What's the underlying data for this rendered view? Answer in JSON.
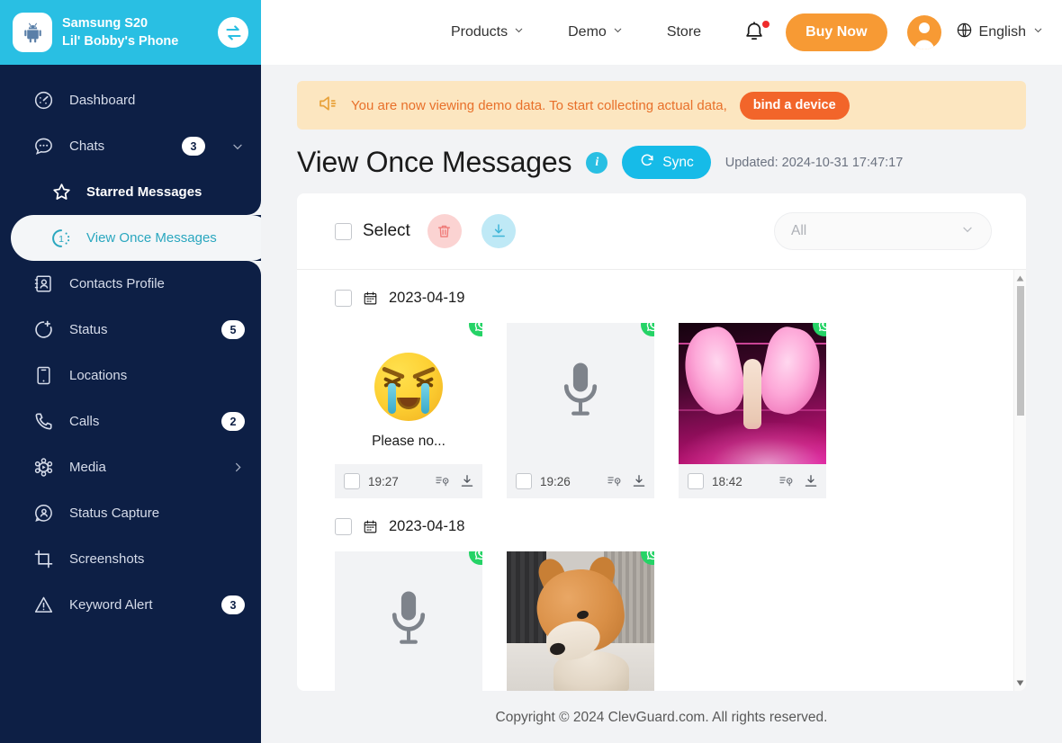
{
  "device": {
    "name": "Samsung S20",
    "sub": "Lil' Bobby's Phone",
    "logo_icon": "android-icon",
    "switch_icon": "switch-device-icon"
  },
  "sidebar": {
    "items": [
      {
        "label": "Dashboard",
        "icon": "dashboard-icon",
        "badge": ""
      },
      {
        "label": "Chats",
        "icon": "chats-icon",
        "badge": "3",
        "chevron": "chevron-down-icon"
      },
      {
        "label": "Contacts Profile",
        "icon": "contacts-profile-icon",
        "badge": ""
      },
      {
        "label": "Status",
        "icon": "status-icon",
        "badge": "5"
      },
      {
        "label": "Locations",
        "icon": "locations-icon",
        "badge": ""
      },
      {
        "label": "Calls",
        "icon": "calls-icon",
        "badge": "2"
      },
      {
        "label": "Media",
        "icon": "media-icon",
        "badge": "",
        "chevron": "chevron-right-icon"
      },
      {
        "label": "Status Capture",
        "icon": "status-capture-icon",
        "badge": ""
      },
      {
        "label": "Screenshots",
        "icon": "screenshots-icon",
        "badge": ""
      },
      {
        "label": "Keyword Alert",
        "icon": "keyword-alert-icon",
        "badge": "3"
      }
    ],
    "sub_items": [
      {
        "label": "Starred Messages",
        "icon": "star-icon",
        "active": false
      },
      {
        "label": "View Once Messages",
        "icon": "view-once-icon",
        "active": true
      }
    ]
  },
  "topnav": {
    "links": [
      {
        "label": "Products",
        "chevron": true
      },
      {
        "label": "Demo",
        "chevron": true
      },
      {
        "label": "Store",
        "chevron": false
      }
    ],
    "bell_icon": "notification-bell-icon",
    "buy_now": "Buy Now",
    "avatar_icon": "user-avatar-icon",
    "language": "English",
    "globe_icon": "globe-icon"
  },
  "banner": {
    "icon": "megaphone-icon",
    "text": "You are now viewing demo data. To start collecting actual data,",
    "button": "bind a device"
  },
  "page": {
    "title": "View Once Messages",
    "info_icon": "info-icon",
    "info_glyph": "i",
    "sync_label": "Sync",
    "sync_icon": "sync-icon",
    "updated": "Updated: 2024-10-31 17:47:17"
  },
  "toolbar": {
    "select_label": "Select",
    "delete_icon": "trash-icon",
    "download_icon": "download-icon",
    "filter_value": "All",
    "filter_chevron": "chevron-down-icon"
  },
  "groups": [
    {
      "date": "2023-04-19",
      "calendar_icon": "calendar-icon",
      "cards": [
        {
          "kind": "text",
          "caption": "Please no...",
          "time": "19:27",
          "app": "whatsapp-icon",
          "white": true,
          "detail_icon": "message-detail-icon",
          "download_icon": "download-icon"
        },
        {
          "kind": "voice",
          "caption": "",
          "time": "19:26",
          "app": "whatsapp-icon",
          "white": false,
          "voice_icon": "microphone-icon",
          "detail_icon": "message-detail-icon",
          "download_icon": "download-icon"
        },
        {
          "kind": "image-angel",
          "caption": "",
          "time": "18:42",
          "app": "whatsapp-icon",
          "white": false,
          "detail_icon": "message-detail-icon",
          "download_icon": "download-icon"
        }
      ]
    },
    {
      "date": "2023-04-18",
      "calendar_icon": "calendar-icon",
      "cards": [
        {
          "kind": "voice",
          "caption": "",
          "time": "",
          "app": "whatsapp-icon",
          "white": false,
          "voice_icon": "microphone-icon"
        },
        {
          "kind": "image-shiba",
          "caption": "",
          "time": "",
          "app": "whatsapp-icon",
          "white": true
        }
      ]
    }
  ],
  "scrollbar": {
    "up_icon": "scroll-up-arrow-icon",
    "down_icon": "scroll-down-arrow-icon",
    "thumb": "scroll-thumb"
  },
  "footer": {
    "copyright": "Copyright © 2024 ClevGuard.com. All rights reserved."
  },
  "colors": {
    "sidebar_bg": "#0d1f45",
    "device_header": "#29bfe3",
    "accent_orange": "#f79a34",
    "bind_orange": "#f2652a",
    "banner_bg": "#fce6c0",
    "sync_blue": "#16bbe8",
    "active_teal": "#2aa7bf",
    "whatsapp_green": "#25d366",
    "page_bg": "#f2f3f5"
  }
}
